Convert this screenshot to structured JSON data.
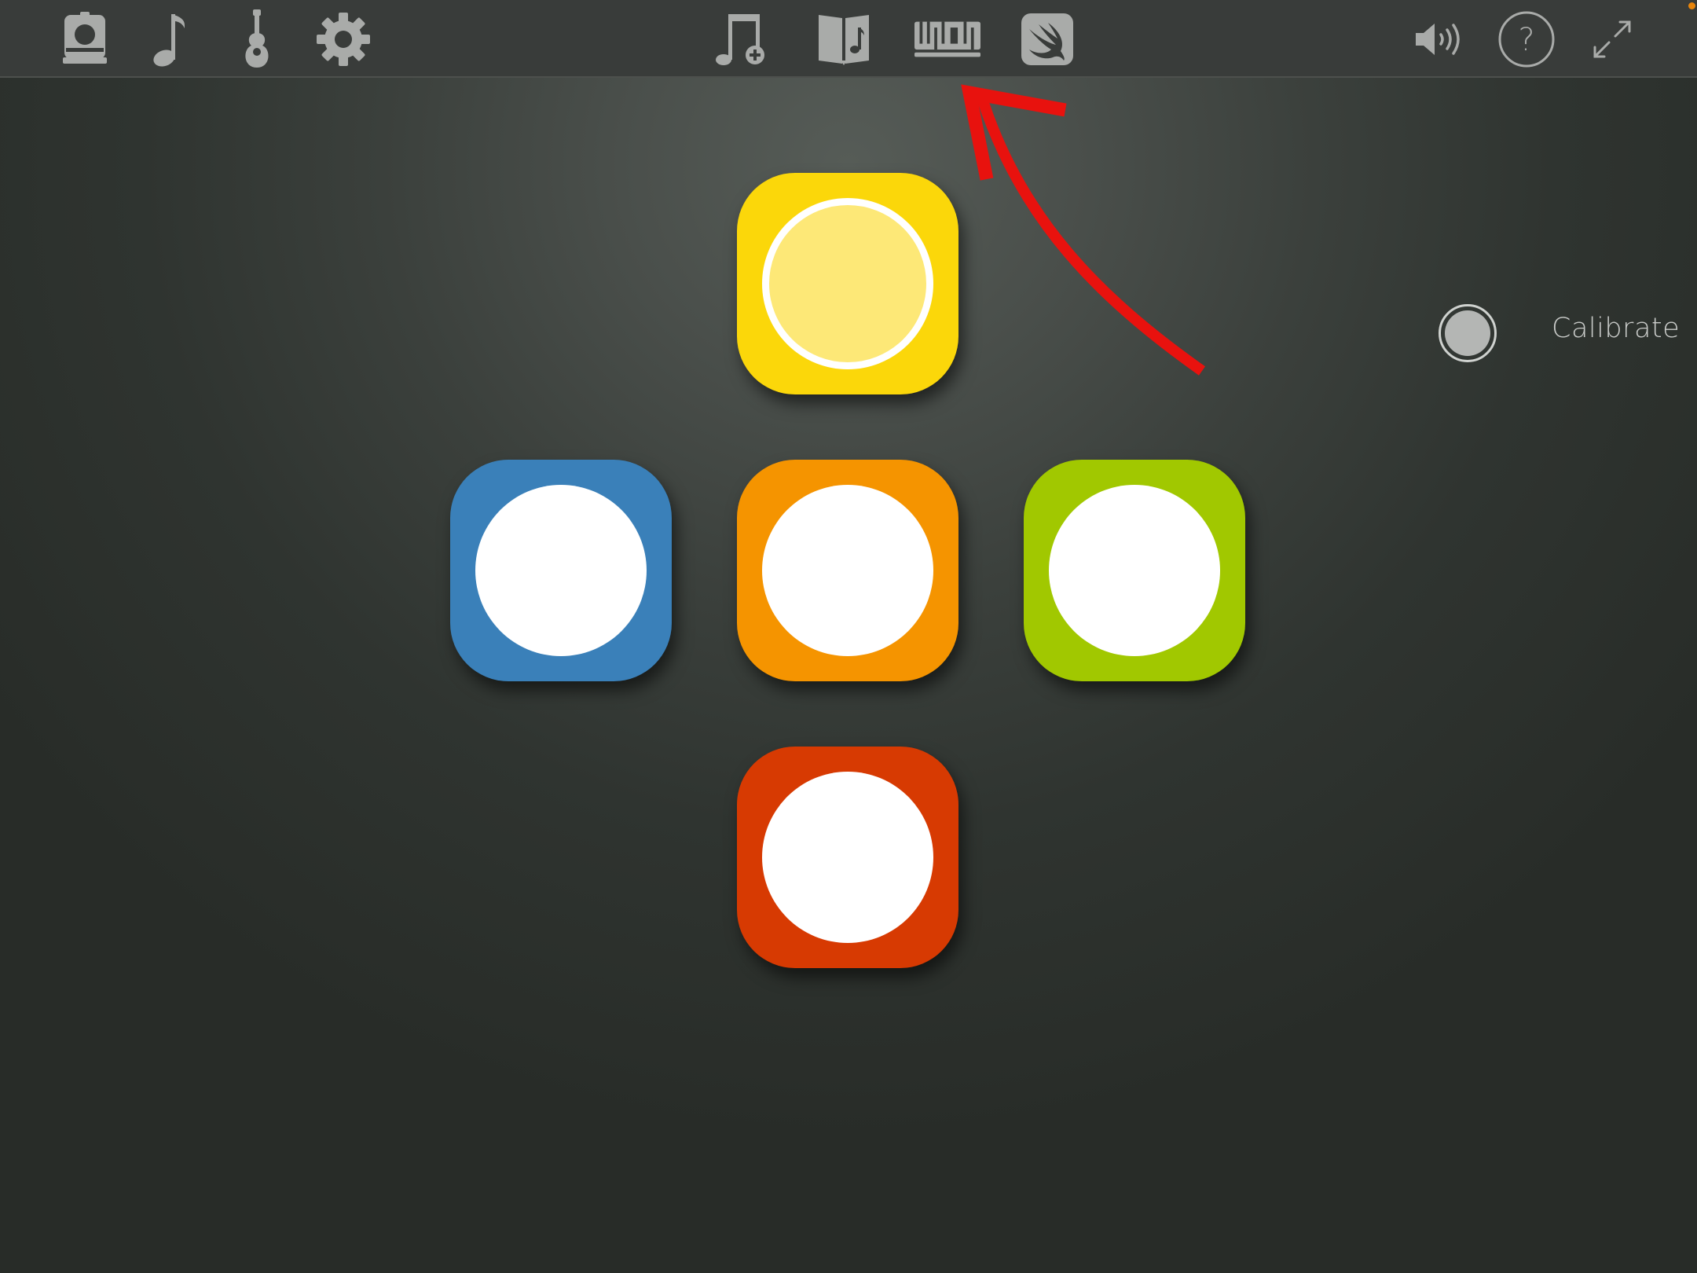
{
  "toolbar": {
    "left": [
      {
        "icon": "speaker-device-icon",
        "name": "toolbar-device-button"
      },
      {
        "icon": "music-note-icon",
        "name": "toolbar-note-button"
      },
      {
        "icon": "guitar-icon",
        "name": "toolbar-instrument-button"
      },
      {
        "icon": "gear-icon",
        "name": "toolbar-settings-button"
      }
    ],
    "center": [
      {
        "icon": "add-song-icon",
        "name": "toolbar-add-song-button"
      },
      {
        "icon": "songbook-icon",
        "name": "toolbar-songbook-button"
      },
      {
        "icon": "midi-icon",
        "name": "toolbar-midi-button",
        "text": "MIDI"
      },
      {
        "icon": "swift-icon",
        "name": "toolbar-swift-button"
      }
    ],
    "right": [
      {
        "icon": "volume-icon",
        "name": "toolbar-volume-button"
      },
      {
        "icon": "help-icon",
        "name": "toolbar-help-button",
        "text": "?"
      },
      {
        "icon": "fullscreen-icon",
        "name": "toolbar-fullscreen-button"
      }
    ],
    "icon_color": "#a9aba9",
    "status_dot_color": "#e8850c"
  },
  "pads": [
    {
      "name": "pad-yellow",
      "color": "#fbd70a",
      "dot_color": "#fde877",
      "active": true
    },
    {
      "name": "pad-blue",
      "color": "#3a80b9",
      "dot_color": "#ffffff",
      "active": false
    },
    {
      "name": "pad-orange",
      "color": "#f59400",
      "dot_color": "#ffffff",
      "active": false
    },
    {
      "name": "pad-green",
      "color": "#a1c800",
      "dot_color": "#ffffff",
      "active": false
    },
    {
      "name": "pad-red",
      "color": "#d73a02",
      "dot_color": "#ffffff",
      "active": false
    }
  ],
  "calibrate": {
    "label": "Calibrate",
    "enabled": false,
    "label_color": "#c9cbc9"
  },
  "annotation": {
    "type": "arrow",
    "color": "#e8120e",
    "points_to": "toolbar-midi-button"
  }
}
